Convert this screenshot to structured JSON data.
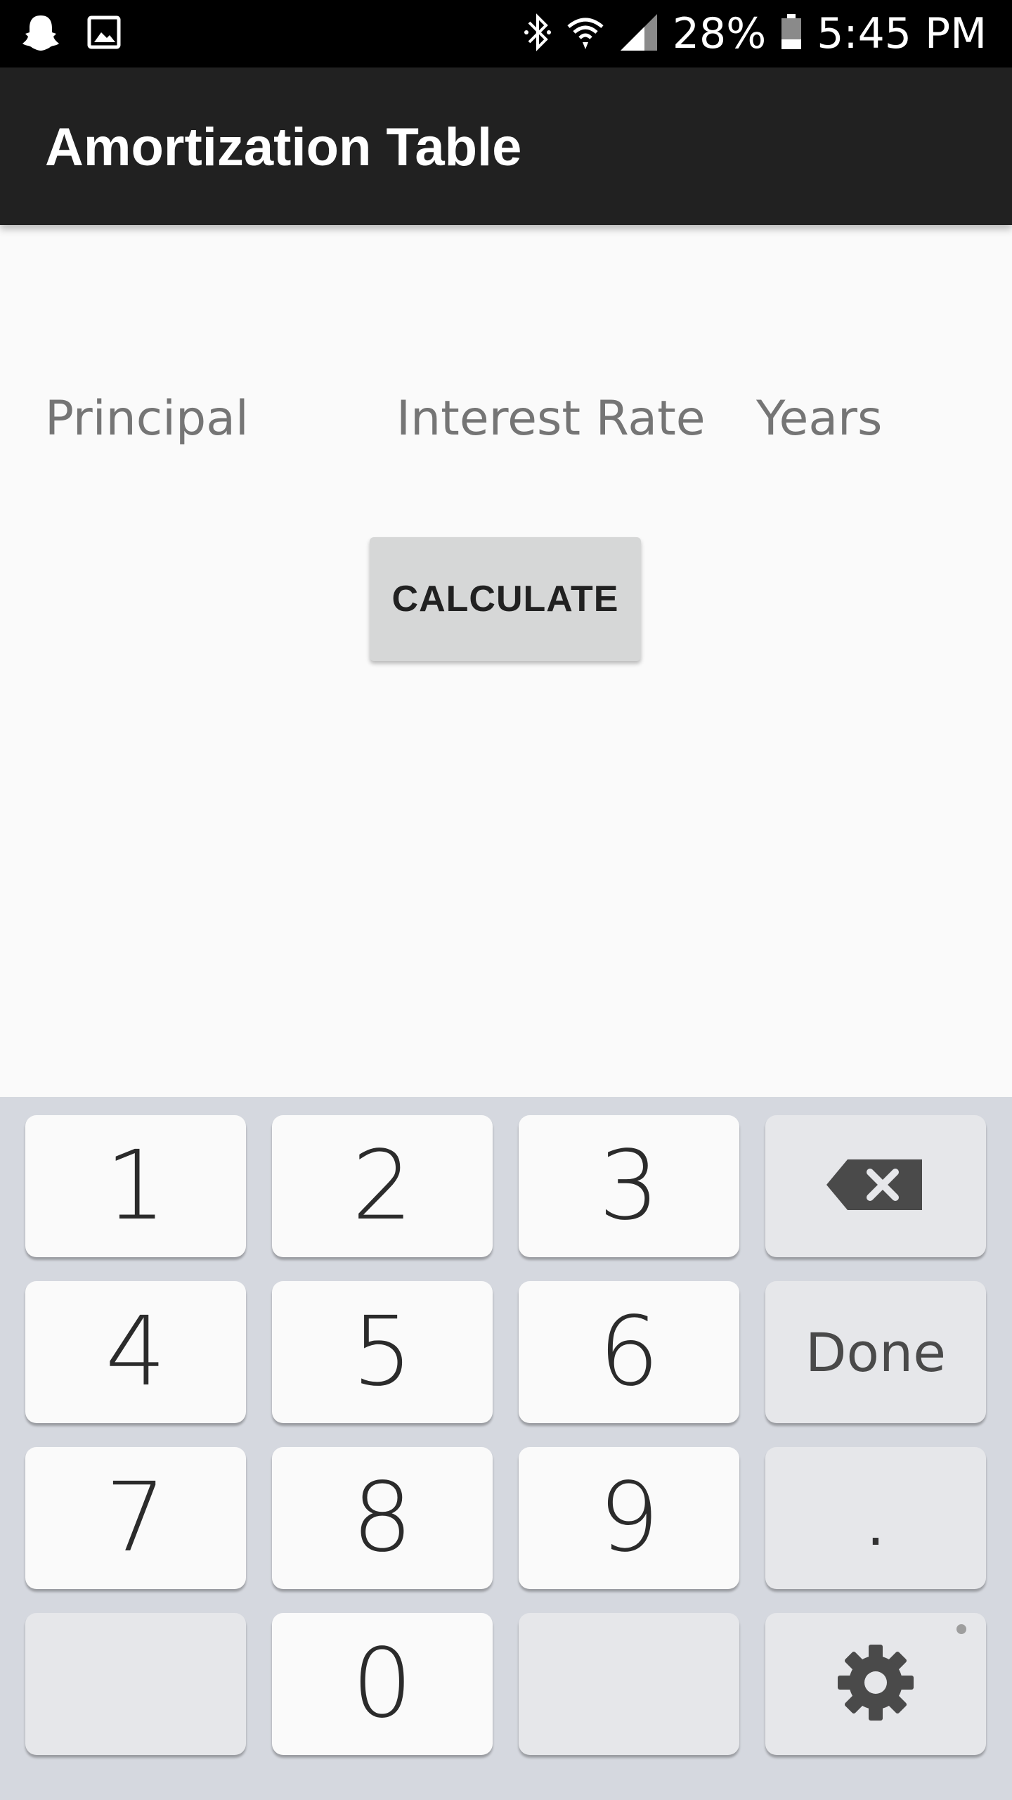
{
  "status_bar": {
    "battery": "28%",
    "time": "5:45 PM",
    "icons": [
      "snapchat-icon",
      "gallery-icon",
      "bluetooth-icon",
      "wifi-icon",
      "signal-icon",
      "battery-icon"
    ]
  },
  "app_bar": {
    "title": "Amortization Table"
  },
  "form": {
    "principal_hint": "Principal",
    "interest_hint": "Interest Rate",
    "years_hint": "Years",
    "calculate_label": "CALCULATE"
  },
  "keyboard": {
    "keys": {
      "k1": "1",
      "k2": "2",
      "k3": "3",
      "k4": "4",
      "k5": "5",
      "k6": "6",
      "k7": "7",
      "k8": "8",
      "k9": "9",
      "k0": "0",
      "done": "Done",
      "dot": "."
    },
    "icons": [
      "backspace-icon",
      "settings-gear-icon"
    ]
  },
  "colors": {
    "status_bar_bg": "#000000",
    "app_bar_bg": "#212121",
    "page_bg": "#fafafa",
    "button_bg": "#d6d7d7",
    "keyboard_bg": "#d5d8df",
    "key_bg": "#fafafa",
    "func_key_bg": "#e6e7ea"
  }
}
